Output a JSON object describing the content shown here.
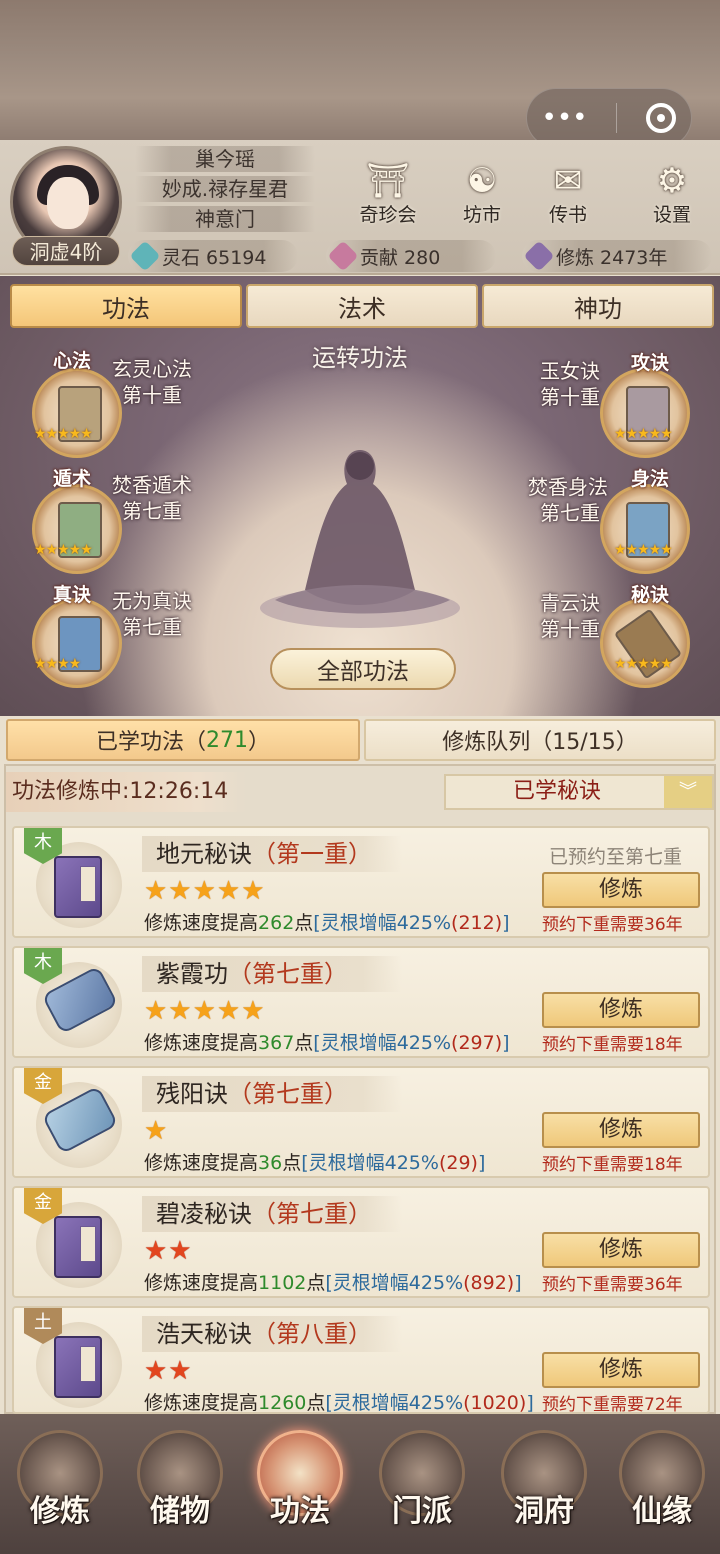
{
  "profile": {
    "name": "巢今瑶",
    "title": "妙成.禄存星君",
    "sect": "神意门",
    "rank": "洞虚4阶"
  },
  "top_buttons": [
    {
      "label": "奇珍会",
      "icon": "treasure-pavilion-icon"
    },
    {
      "label": "坊市",
      "icon": "market-icon"
    },
    {
      "label": "传书",
      "icon": "letter-scroll-icon"
    },
    {
      "label": "设置",
      "icon": "gear-icon"
    }
  ],
  "resources": [
    {
      "label": "灵石 65194",
      "icon": "spirit-stone-icon",
      "color": "#5fb4b8"
    },
    {
      "label": "贡献 280",
      "icon": "contribution-icon",
      "color": "#c77a9e"
    },
    {
      "label": "修炼 2473年",
      "icon": "cultivation-icon",
      "color": "#8a6fa8"
    }
  ],
  "tabs": [
    "功法",
    "法术",
    "神功"
  ],
  "scene_title": "运转功法",
  "slots": [
    {
      "tag": "心法",
      "name": "玄灵心法",
      "level": "第十重",
      "stars": 5
    },
    {
      "tag": "攻诀",
      "name": "玉女诀",
      "level": "第十重",
      "stars": 5
    },
    {
      "tag": "遁术",
      "name": "焚香遁术",
      "level": "第七重",
      "stars": 5
    },
    {
      "tag": "身法",
      "name": "焚香身法",
      "level": "第七重",
      "stars": 5
    },
    {
      "tag": "真诀",
      "name": "无为真诀",
      "level": "第七重",
      "stars": 4
    },
    {
      "tag": "秘诀",
      "name": "青云诀",
      "level": "第十重",
      "stars": 5
    }
  ],
  "all_button": "全部功法",
  "subtabs": {
    "learned": "已学功法（",
    "learned_count": "271",
    "learned_close": "）",
    "queue": "修炼队列（15/15）"
  },
  "status": "功法修炼中:12:26:14",
  "filter": "已学秘诀",
  "items": [
    {
      "element": "木",
      "element_color": "#6aa84f",
      "name": "地元秘诀",
      "level": "（第一重）",
      "stars": 5,
      "star_color": "gold",
      "desc_prefix": "修炼速度提高",
      "speed": "262",
      "desc_mid": "点",
      "bonus": "[灵根增幅425%",
      "bonus_val": "(212)",
      "bonus_end": "]",
      "need": "预约下重需要36年",
      "reserve": "已预约至第七重",
      "button": "修炼"
    },
    {
      "element": "木",
      "element_color": "#6aa84f",
      "name": "紫霞功",
      "level": "（第七重）",
      "stars": 5,
      "star_color": "gold",
      "desc_prefix": "修炼速度提高",
      "speed": "367",
      "desc_mid": "点",
      "bonus": "[灵根增幅425%",
      "bonus_val": "(297)",
      "bonus_end": "]",
      "need": "预约下重需要18年",
      "reserve": "",
      "button": "修炼"
    },
    {
      "element": "金",
      "element_color": "#d8a63a",
      "name": "残阳诀",
      "level": "（第七重）",
      "stars": 1,
      "star_color": "gold",
      "desc_prefix": "修炼速度提高",
      "speed": "36",
      "desc_mid": "点",
      "bonus": "[灵根增幅425%",
      "bonus_val": "(29)",
      "bonus_end": "]",
      "need": "预约下重需要18年",
      "reserve": "",
      "button": "修炼"
    },
    {
      "element": "金",
      "element_color": "#d8a63a",
      "name": "碧凌秘诀",
      "level": "（第七重）",
      "stars": 2,
      "star_color": "red",
      "desc_prefix": "修炼速度提高",
      "speed": "1102",
      "desc_mid": "点",
      "bonus": "[灵根增幅425%",
      "bonus_val": "(892)",
      "bonus_end": "]",
      "need": "预约下重需要36年",
      "reserve": "",
      "button": "修炼"
    },
    {
      "element": "土",
      "element_color": "#b08a5a",
      "name": "浩天秘诀",
      "level": "（第八重）",
      "stars": 2,
      "star_color": "red",
      "desc_prefix": "修炼速度提高",
      "speed": "1260",
      "desc_mid": "点",
      "bonus": "[灵根增幅425%",
      "bonus_val": "(1020)",
      "bonus_end": "]",
      "need": "预约下重需要72年",
      "reserve": "",
      "button": "修炼"
    }
  ],
  "bottom_nav": [
    "修炼",
    "储物",
    "功法",
    "门派",
    "洞府",
    "仙缘"
  ],
  "active_nav": "功法"
}
